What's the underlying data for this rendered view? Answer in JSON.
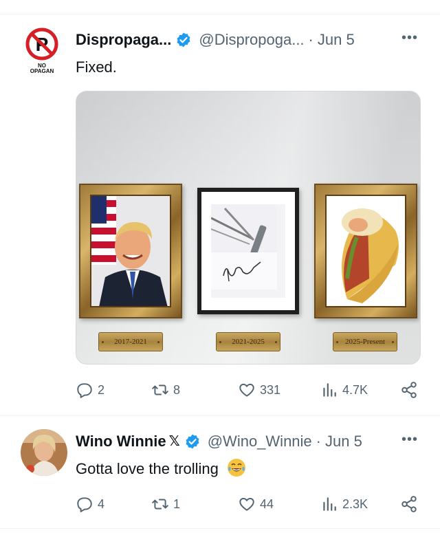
{
  "tweets": [
    {
      "name": "Dispropaga...",
      "handle": "@Dispropoga...",
      "separator": "·",
      "date": "Jun 5",
      "more": "•••",
      "text": "Fixed.",
      "avatar": {
        "icon": "no-parking-icon",
        "caption_top": "NO",
        "caption_bottom": "OPAGAN"
      },
      "image": {
        "plaques": [
          "2017-2021",
          "2021-2025",
          "2025-Present"
        ]
      },
      "stats": {
        "replies": "2",
        "reposts": "8",
        "likes": "331",
        "views": "4.7K"
      }
    },
    {
      "name": "Wino Winnie",
      "name_badge": "𝕏",
      "handle": "@Wino_Winnie",
      "separator": "·",
      "date": "Jun 5",
      "more": "•••",
      "text": "Gotta love the trolling",
      "emoji": "laughing-crying-emoji",
      "stats": {
        "replies": "4",
        "reposts": "1",
        "likes": "44",
        "views": "2.3K"
      }
    }
  ],
  "colors": {
    "verified": "#1d9bf0",
    "text": "#0f1419",
    "muted": "#536471",
    "divider": "#eff3f4",
    "emoji": "#f7c23e"
  }
}
